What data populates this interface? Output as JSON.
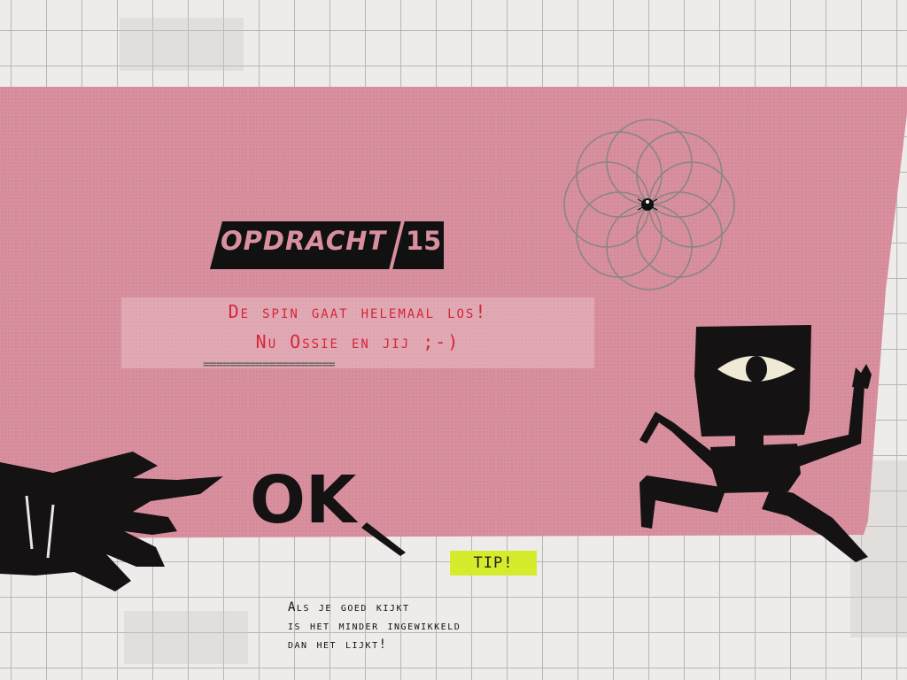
{
  "assignment": {
    "label": "OPDRACHT",
    "number": "15"
  },
  "message": {
    "line1": "De spin gaat helemaal los!",
    "line2": "Nu Ossie en jij ;-)",
    "rule": "===================="
  },
  "ok_button": {
    "label": "OK"
  },
  "tip": {
    "button_label": "TIP!",
    "text": "Als je goed kijkt\nis het minder ingewikkeld\ndan het lijkt!"
  },
  "colors": {
    "sheet": "#d9909e",
    "accent_text": "#d6243a",
    "tip_highlight": "#d4ec2c",
    "ink": "#111111"
  },
  "icons": {
    "rosette": "spirograph-rosette-icon",
    "spider": "spider-dot-icon",
    "character": "ossie-running-figure-icon",
    "hand": "pointing-hand-icon"
  }
}
